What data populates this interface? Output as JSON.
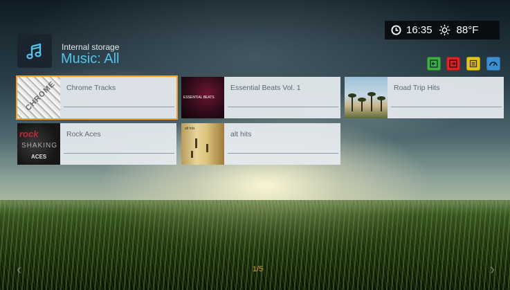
{
  "header": {
    "source": "Internal storage",
    "view_title": "Music: All",
    "app_icon": "music-note-icon"
  },
  "status": {
    "time": "16:35",
    "temperature": "88°F",
    "clock_icon": "clock-icon",
    "weather_icon": "sun-icon"
  },
  "color_buttons": [
    {
      "color": "#3fae43",
      "icon": "back-arrow-icon"
    },
    {
      "color": "#d8252a",
      "icon": "exit-arrow-icon"
    },
    {
      "color": "#e2c41b",
      "icon": "list-icon"
    },
    {
      "color": "#3b8fd1",
      "icon": "speedometer-icon"
    }
  ],
  "albums": [
    {
      "title": "Chrome Tracks",
      "art_text": "CHROME",
      "selected": true
    },
    {
      "title": "Essential Beats Vol. 1",
      "art_text": "ESSENTIAL BEATS"
    },
    {
      "title": "Road Trip Hits",
      "art_text": ""
    },
    {
      "title": "Rock Aces",
      "art_text": [
        "rock",
        "SHAKING",
        "ACES"
      ]
    },
    {
      "title": "alt hits",
      "art_text": "alt hits"
    }
  ],
  "pagination": {
    "indicator": "1/5",
    "prev_arrow": "‹",
    "next_arrow": "›"
  }
}
